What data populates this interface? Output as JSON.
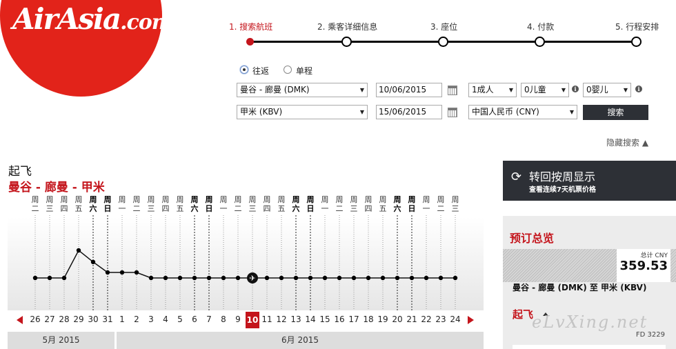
{
  "logo": {
    "main": "AirAsia",
    "domain": ".com"
  },
  "steps": [
    {
      "label": "1. 搜索航班",
      "active": true
    },
    {
      "label": "2. 乘客详细信息",
      "active": false
    },
    {
      "label": "3. 座位",
      "active": false
    },
    {
      "label": "4. 付款",
      "active": false
    },
    {
      "label": "5. 行程安排",
      "active": false
    }
  ],
  "form": {
    "trip_round": "往返",
    "trip_oneway": "单程",
    "origin": "曼谷 - 廊曼 (DMK)",
    "destination": "甲米 (KBV)",
    "depart_date": "10/06/2015",
    "return_date": "15/06/2015",
    "adults": "1成人",
    "children": "0儿童",
    "infants": "0婴儿",
    "currency": "中国人民币 (CNY)",
    "search_label": "搜索",
    "info_icon": "i",
    "hide_search": "隐藏搜索 ▲"
  },
  "depart": {
    "title": "起飞",
    "route": "曼谷 - 廊曼 - 甲米"
  },
  "chart_data": {
    "type": "line",
    "weekdays": [
      "周二",
      "周三",
      "周四",
      "周五",
      "周六",
      "周日",
      "周一",
      "周二",
      "周三",
      "周四",
      "周五",
      "周六",
      "周日",
      "周一",
      "周二",
      "周三",
      "周四",
      "周五",
      "周六",
      "周日",
      "周一",
      "周二",
      "周三",
      "周四",
      "周五",
      "周六",
      "周日",
      "周一",
      "周二",
      "周三"
    ],
    "weekend": [
      false,
      false,
      false,
      false,
      true,
      true,
      false,
      false,
      false,
      false,
      false,
      true,
      true,
      false,
      false,
      false,
      false,
      false,
      true,
      true,
      false,
      false,
      false,
      false,
      false,
      true,
      true,
      false,
      false,
      false
    ],
    "dates": [
      "26",
      "27",
      "28",
      "29",
      "30",
      "31",
      "1",
      "2",
      "3",
      "4",
      "5",
      "6",
      "7",
      "8",
      "9",
      "10",
      "11",
      "12",
      "13",
      "14",
      "15",
      "16",
      "17",
      "18",
      "19",
      "20",
      "21",
      "22",
      "23",
      "24"
    ],
    "levels": [
      0,
      0,
      0,
      1,
      0.58,
      0.2,
      0.2,
      0.2,
      0,
      0,
      0,
      0,
      0,
      0,
      0,
      0,
      0,
      0,
      0,
      0,
      0,
      0,
      0,
      0,
      0,
      0,
      0,
      0,
      0,
      0
    ],
    "selected_index": 15,
    "months": [
      {
        "label": "5月 2015"
      },
      {
        "label": "6月 2015"
      }
    ]
  },
  "week_panel": {
    "title": "转回按周显示",
    "subtitle": "查看连续7天机票价格"
  },
  "summary": {
    "title": "预订总览",
    "total_label": "总计 CNY",
    "total_amount": "359.53",
    "route": "曼谷 - 廊曼 (DMK) 至 甲米 (KBV)",
    "depart_label": "起飞",
    "flight_no": "FD 3229",
    "watermark": "eLvXing.net"
  },
  "colors": {
    "brand": "#c4151c",
    "dark": "#2d3036"
  }
}
